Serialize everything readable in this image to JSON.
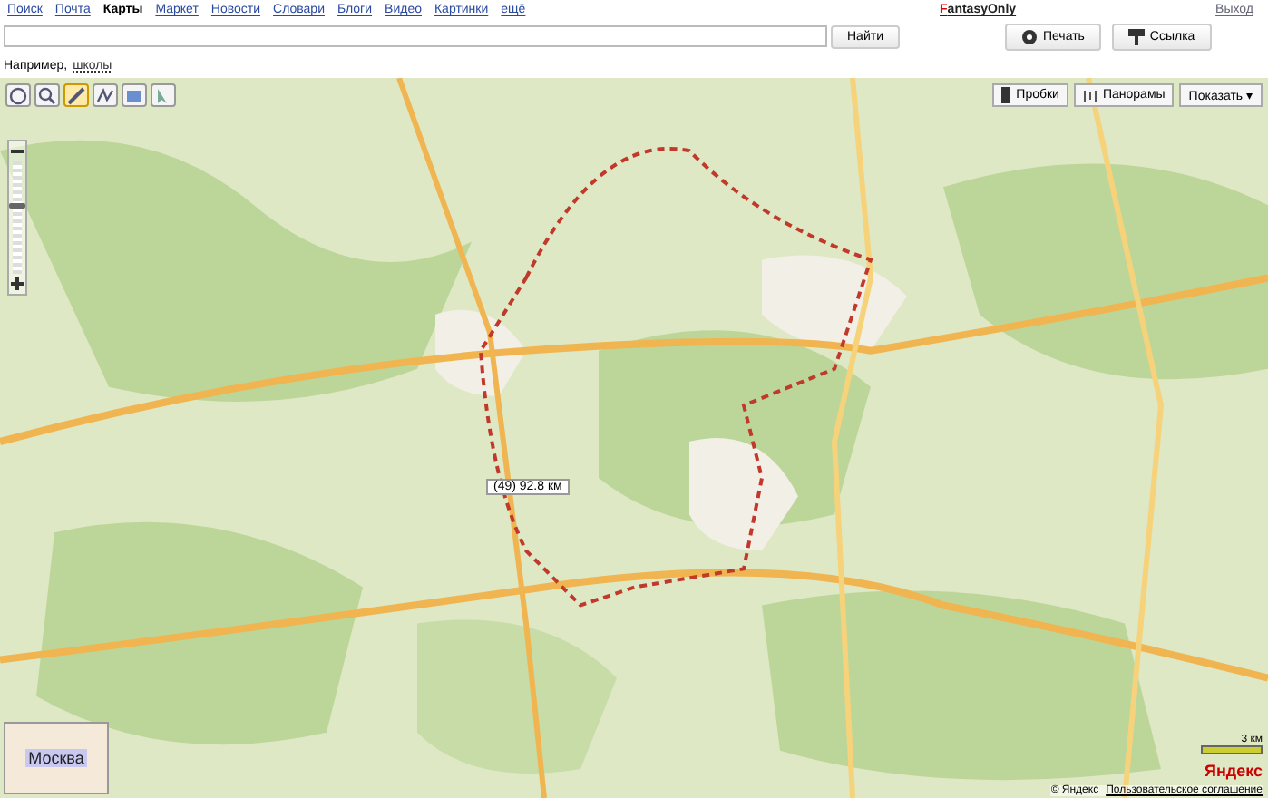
{
  "nav": [
    {
      "label": "Поиск",
      "selected": false
    },
    {
      "label": "Почта",
      "selected": false
    },
    {
      "label": "Карты",
      "selected": true
    },
    {
      "label": "Маркет",
      "selected": false
    },
    {
      "label": "Новости",
      "selected": false
    },
    {
      "label": "Словари",
      "selected": false
    },
    {
      "label": "Блоги",
      "selected": false
    },
    {
      "label": "Видео",
      "selected": false
    },
    {
      "label": "Картинки",
      "selected": false
    },
    {
      "label": "ещё",
      "selected": false
    }
  ],
  "user": "FantasyOnly",
  "logout": "Выход",
  "search": {
    "button": "Найти",
    "hint_prefix": "Например,",
    "hint_link": "школы"
  },
  "actions": [
    {
      "kind": "print",
      "label": "Печать"
    },
    {
      "kind": "link",
      "label": "Ссылка"
    }
  ],
  "map": {
    "tools": [
      {
        "kind": "hand",
        "selected": false
      },
      {
        "kind": "zoom",
        "selected": false
      },
      {
        "kind": "ruler",
        "selected": true
      },
      {
        "kind": "route",
        "selected": false
      },
      {
        "kind": "screen",
        "selected": false
      },
      {
        "kind": "pointer",
        "selected": false
      }
    ],
    "layers": [
      {
        "kind": "traffic",
        "label": "Пробки"
      },
      {
        "kind": "panorama",
        "label": "Панорамы"
      },
      {
        "kind": "menu",
        "label": "Показать ▾"
      }
    ],
    "zoom": {
      "level": 0.6
    },
    "route_distance": "92.8 км",
    "route_count": "(49)",
    "scale": "3 км",
    "logo": "Яндекс",
    "copyright": "© Яндекс",
    "agreement": "Пользовательское соглашение",
    "minimap_label": "Москва"
  }
}
